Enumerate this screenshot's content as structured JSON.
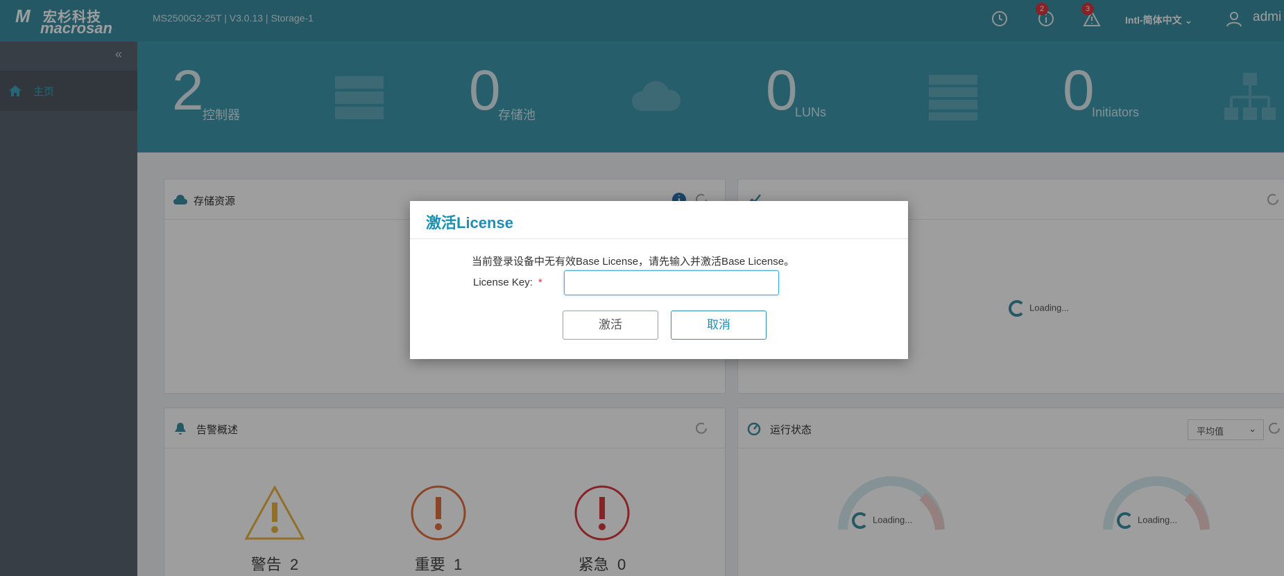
{
  "header": {
    "logo_cn": "宏杉科技",
    "logo_en": "macrosan",
    "device_info": "MS2500G2-25T | V3.0.13 | Storage-1",
    "notifications_count": "2",
    "alerts_count": "3",
    "language": "Intl-简体中文",
    "user": "admi"
  },
  "sidebar": {
    "collapse": "«",
    "items": [
      {
        "label": "主页",
        "icon": "home-icon"
      }
    ]
  },
  "stats": [
    {
      "value": "2",
      "label": "控制器"
    },
    {
      "value": "0",
      "label": "存储池"
    },
    {
      "value": "0",
      "label": "LUNs"
    },
    {
      "value": "0",
      "label": "Initiators"
    }
  ],
  "panels": {
    "storage": {
      "title": "存储资源"
    },
    "performance": {
      "loading": "Loading..."
    },
    "alarms": {
      "title": "告警概述",
      "items": [
        {
          "label": "警告",
          "count": "2"
        },
        {
          "label": "重要",
          "count": "1"
        },
        {
          "label": "紧急",
          "count": "0"
        }
      ]
    },
    "running": {
      "title": "运行状态",
      "select": "平均值",
      "gauges": [
        {
          "loading": "Loading..."
        },
        {
          "loading": "Loading..."
        }
      ]
    }
  },
  "modal": {
    "title": "激活License",
    "message": "当前登录设备中无有效Base License，请先输入并激活Base License。",
    "key_label": "License Key:",
    "required_mark": "*",
    "key_value": "",
    "activate_label": "激活",
    "cancel_label": "取消"
  },
  "colors": {
    "header": "#3a8fa3",
    "accent": "#1b8fb4",
    "sidebar": "#5b6470",
    "danger": "#d9393f",
    "warning": "#e8b341"
  }
}
